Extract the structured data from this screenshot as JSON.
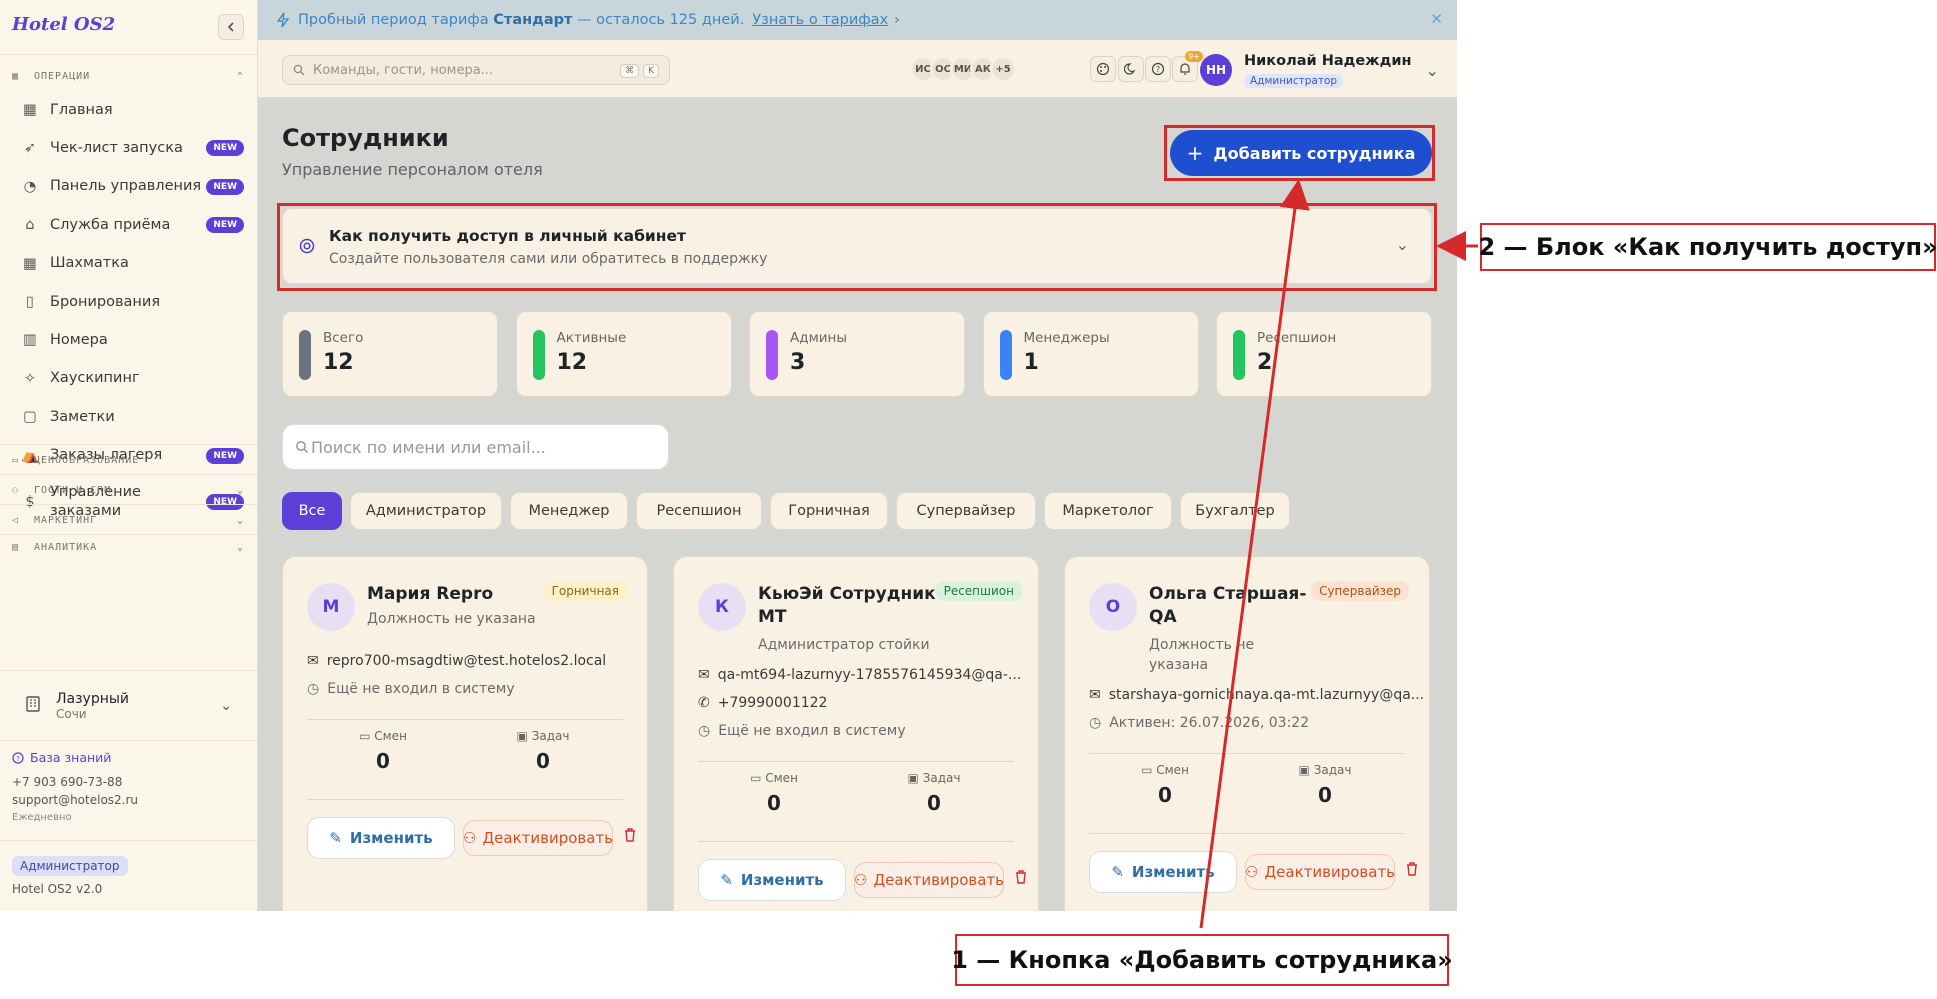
{
  "sidebar": {
    "logo": "Hotel OS2",
    "sections": {
      "operations": "ОПЕРАЦИИ",
      "pricing": "ЦЕНООБРАЗОВАНИЕ",
      "guests": "ГОСТИ И CRM",
      "marketing": "МАРКЕТИНГ",
      "analytics": "АНАЛИТИКА"
    },
    "items": [
      {
        "label": "Главная",
        "icon": "grid-icon",
        "badge": ""
      },
      {
        "label": "Чек-лист запуска",
        "icon": "rocket-icon",
        "badge": "NEW"
      },
      {
        "label": "Панель управления",
        "icon": "gauge-icon",
        "badge": "NEW"
      },
      {
        "label": "Служба приёма",
        "icon": "bell-desk-icon",
        "badge": "NEW"
      },
      {
        "label": "Шахматка",
        "icon": "table-icon",
        "badge": ""
      },
      {
        "label": "Бронирования",
        "icon": "clipboard-icon",
        "badge": ""
      },
      {
        "label": "Номера",
        "icon": "building-icon",
        "badge": ""
      },
      {
        "label": "Хаускипинг",
        "icon": "sparkle-icon",
        "badge": ""
      },
      {
        "label": "Заметки",
        "icon": "note-icon",
        "badge": ""
      },
      {
        "label": "Заказы лагеря",
        "icon": "tent-icon",
        "badge": "NEW"
      },
      {
        "label": "Управление",
        "label2": "заказами",
        "icon": "dollar-doc-icon",
        "badge": "NEW"
      }
    ],
    "hotel": {
      "name": "Лазурный",
      "city": "Сочи"
    },
    "help": "База знаний",
    "phone": "+7 903 690-73-88",
    "email": "support@hotelos2.ru",
    "schedule": "Ежедневно",
    "role": "Администратор",
    "version": "Hotel OS2 v2.0"
  },
  "trial": {
    "prefix": "Пробный период тарифа",
    "plan": "Стандарт",
    "suffix": "— осталось 125 дней.",
    "link": "Узнать о тарифах"
  },
  "header": {
    "search_placeholder": "Команды, гости, номера...",
    "kbd1": "⌘",
    "kbd2": "K",
    "avatars": [
      "ИС",
      "ОС",
      "МИ",
      "АК",
      "+5"
    ],
    "notif_count": "9+",
    "user": {
      "initials": "НН",
      "name": "Николай Надеждин",
      "role": "Администратор"
    }
  },
  "page": {
    "title": "Сотрудники",
    "subtitle": "Управление персоналом отеля",
    "add_button": "Добавить сотрудника",
    "access": {
      "title": "Как получить доступ в личный кабинет",
      "subtitle": "Создайте пользователя сами или обратитесь в поддержку"
    },
    "stats": [
      {
        "label": "Всего",
        "value": "12",
        "color": "#6b7280"
      },
      {
        "label": "Активные",
        "value": "12",
        "color": "#22c55e"
      },
      {
        "label": "Админы",
        "value": "3",
        "color": "#a855f7"
      },
      {
        "label": "Менеджеры",
        "value": "1",
        "color": "#3b82f6"
      },
      {
        "label": "Ресепшион",
        "value": "2",
        "color": "#22c55e"
      }
    ],
    "search_placeholder": "Поиск по имени или email...",
    "filters": [
      "Все",
      "Администратор",
      "Менеджер",
      "Ресепшион",
      "Горничная",
      "Супервайзер",
      "Маркетолог",
      "Бухгалтер"
    ],
    "shifts_label": "Смен",
    "tasks_label": "Задач",
    "edit_label": "Изменить",
    "deactivate_label": "Деактивировать",
    "employees": [
      {
        "initial": "М",
        "name1": "Мария Repro",
        "name2": "",
        "pos1": "Должность не указана",
        "pos2": "",
        "role": "Горничная",
        "email": "repro700-msagdtiw@test.hotelos2.local",
        "phone": "",
        "last": "Ещё не входил в систему",
        "shifts": "0",
        "tasks": "0"
      },
      {
        "initial": "К",
        "name1": "КьюЭй Сотрудник-",
        "name2": "МТ",
        "pos1": "Администратор стойки",
        "pos2": "",
        "role": "Ресепшион",
        "email": "qa-mt694-lazurnyy-1785576145934@qa-...",
        "phone": "+79990001122",
        "last": "Ещё не входил в систему",
        "shifts": "0",
        "tasks": "0"
      },
      {
        "initial": "О",
        "name1": "Ольга Старшая-",
        "name2": "QA",
        "pos1": "Должность не",
        "pos2": "указана",
        "role": "Супервайзер",
        "email": "starshaya-gornichnaya.qa-mt.lazurnyy@qa...",
        "phone": "",
        "last": "Активен: 26.07.2026, 03:22",
        "shifts": "0",
        "tasks": "0"
      }
    ]
  },
  "annotations": {
    "label1": "1 — Кнопка «Добавить сотрудника»",
    "label2": "2 — Блок «Как получить доступ»"
  },
  "colors": {
    "accent": "#5b3fd6",
    "primary_button": "#1f4fd1",
    "annotation": "#d42a2a"
  }
}
